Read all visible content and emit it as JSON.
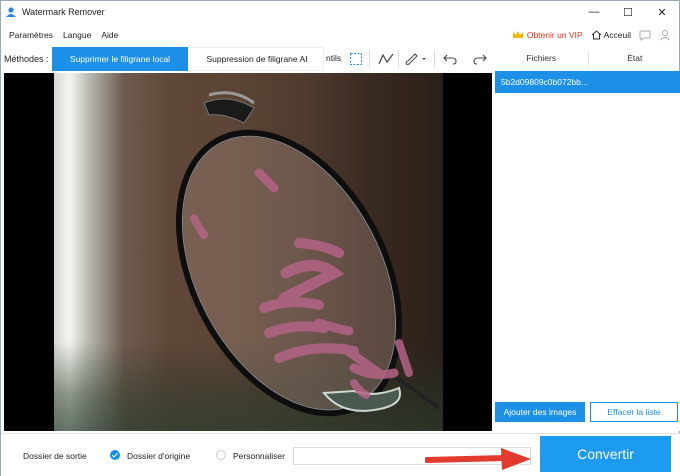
{
  "window": {
    "title": "Watermark Remover",
    "controls": {
      "minimize": "—",
      "maximize": "☐",
      "close": "✕"
    }
  },
  "menu": {
    "items": [
      "Paramètres",
      "Langue",
      "Aide"
    ],
    "vip_label": "Obtenir un VIP",
    "home_label": "Acceuil"
  },
  "toolbar": {
    "methods_label": "Méthodes :",
    "tab_local": "Supprimer le filigrane local",
    "tab_ai": "Suppression de filigrane AI",
    "tools_label": "ntils"
  },
  "files": {
    "col_files": "Fichiers",
    "col_state": "État",
    "items": [
      {
        "name": "5b2d09809c0b072bb..."
      }
    ],
    "add_label": "Ajouter des images",
    "clear_label": "Effacer la liste"
  },
  "output": {
    "label": "Dossier de sortie",
    "option_origin": "Dossier d'origine",
    "option_custom": "Personnaliser",
    "path_value": "",
    "convert_label": "Convertir"
  },
  "colors": {
    "accent": "#1c8fe6",
    "vip": "#e0341e",
    "arrow": "#e23a2e",
    "mask": "#b46487"
  },
  "icons": [
    "app-logo-icon",
    "crown-icon",
    "home-icon",
    "chat-icon",
    "user-icon",
    "rectangle-select-icon",
    "polyline-icon",
    "brush-icon",
    "undo-icon",
    "redo-icon",
    "checkmark-icon"
  ]
}
